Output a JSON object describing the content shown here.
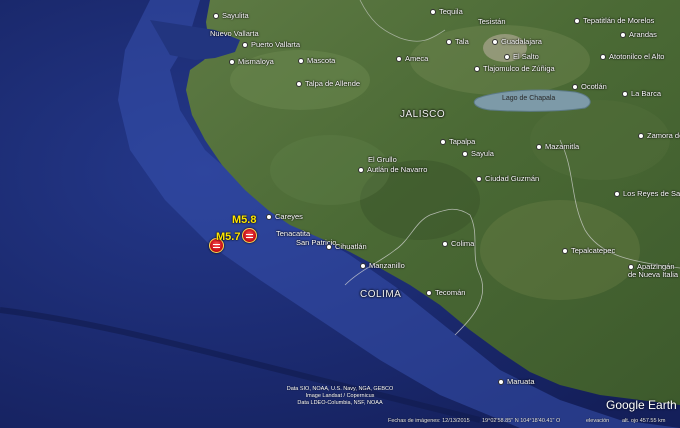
{
  "colors": {
    "ocean_deep": "#16266a",
    "ocean_shelf": "#2f48a6",
    "land": "#4f6b3a",
    "quake_fill": "#c8101a",
    "quake_label": "#ffe600"
  },
  "places": [
    {
      "id": "sayulita",
      "name": "Sayulita"
    },
    {
      "id": "nuevo-vallarta",
      "name": "Nuevo Vallarta"
    },
    {
      "id": "puerto-vallarta",
      "name": "Puerto Vallarta"
    },
    {
      "id": "mascota",
      "name": "Mascota"
    },
    {
      "id": "mismaloya",
      "name": "Mismaloya"
    },
    {
      "id": "talpa",
      "name": "Talpa de Allende"
    },
    {
      "id": "tequila",
      "name": "Tequila"
    },
    {
      "id": "tesistan",
      "name": "Tesistán"
    },
    {
      "id": "guadalajara",
      "name": "Guadalajara"
    },
    {
      "id": "tepatitlan",
      "name": "Tepatitlán de Morelos"
    },
    {
      "id": "tala",
      "name": "Tala"
    },
    {
      "id": "arandas",
      "name": "Arandas"
    },
    {
      "id": "ameca",
      "name": "Ameca"
    },
    {
      "id": "el-salto",
      "name": "El Salto"
    },
    {
      "id": "tlajomulco",
      "name": "Tlajomulco de Zúñiga"
    },
    {
      "id": "atotonilco",
      "name": "Atotonilco el Alto"
    },
    {
      "id": "ocotlan",
      "name": "Ocotlán"
    },
    {
      "id": "la-barca",
      "name": "La Barca"
    },
    {
      "id": "zamora",
      "name": "Zamora de H"
    },
    {
      "id": "tapalpa",
      "name": "Tapalpa"
    },
    {
      "id": "sayula",
      "name": "Sayula"
    },
    {
      "id": "mazamitla",
      "name": "Mazamitla"
    },
    {
      "id": "el-grullo",
      "name": "El Grullo"
    },
    {
      "id": "autlan",
      "name": "Autlán de Navarro"
    },
    {
      "id": "ciudad-guzman",
      "name": "Ciudad Guzmán"
    },
    {
      "id": "los-reyes",
      "name": "Los Reyes de Sa"
    },
    {
      "id": "careyes",
      "name": "Careyes"
    },
    {
      "id": "tenacatita",
      "name": "Tenacatita"
    },
    {
      "id": "san-patricio",
      "name": "San Patricio"
    },
    {
      "id": "cihuatlan",
      "name": "Cihuatlán"
    },
    {
      "id": "colima-city",
      "name": "Colima"
    },
    {
      "id": "tepalcatepec",
      "name": "Tepalcatepec"
    },
    {
      "id": "manzanillo",
      "name": "Manzanillo"
    },
    {
      "id": "apatzingan",
      "name": "Apatzingán de Nueva Italia"
    },
    {
      "id": "tecoman",
      "name": "Tecomán"
    },
    {
      "id": "maruata",
      "name": "Maruata"
    }
  ],
  "regions": {
    "jalisco": "JALISCO",
    "colima": "COLIMA",
    "lake": "Lago de Chapala"
  },
  "quakes": [
    {
      "id": "m58",
      "label": "M5.8"
    },
    {
      "id": "m57",
      "label": "M5.7"
    }
  ],
  "credits": [
    "Data SIO, NOAA, U.S. Navy, NGA, GEBCO",
    "Image Landsat / Copernicus",
    "Data LDEO-Columbia, NSF, NOAA"
  ],
  "footer": {
    "imagery_date": "Fechas de imágenes: 12/13/2015",
    "coords": "19°02'58.85\" N  104°18'40.41\" O",
    "elevation": "elevación",
    "eye_alt": "alt. ojo 457.55 km"
  },
  "brand": "Google Earth"
}
